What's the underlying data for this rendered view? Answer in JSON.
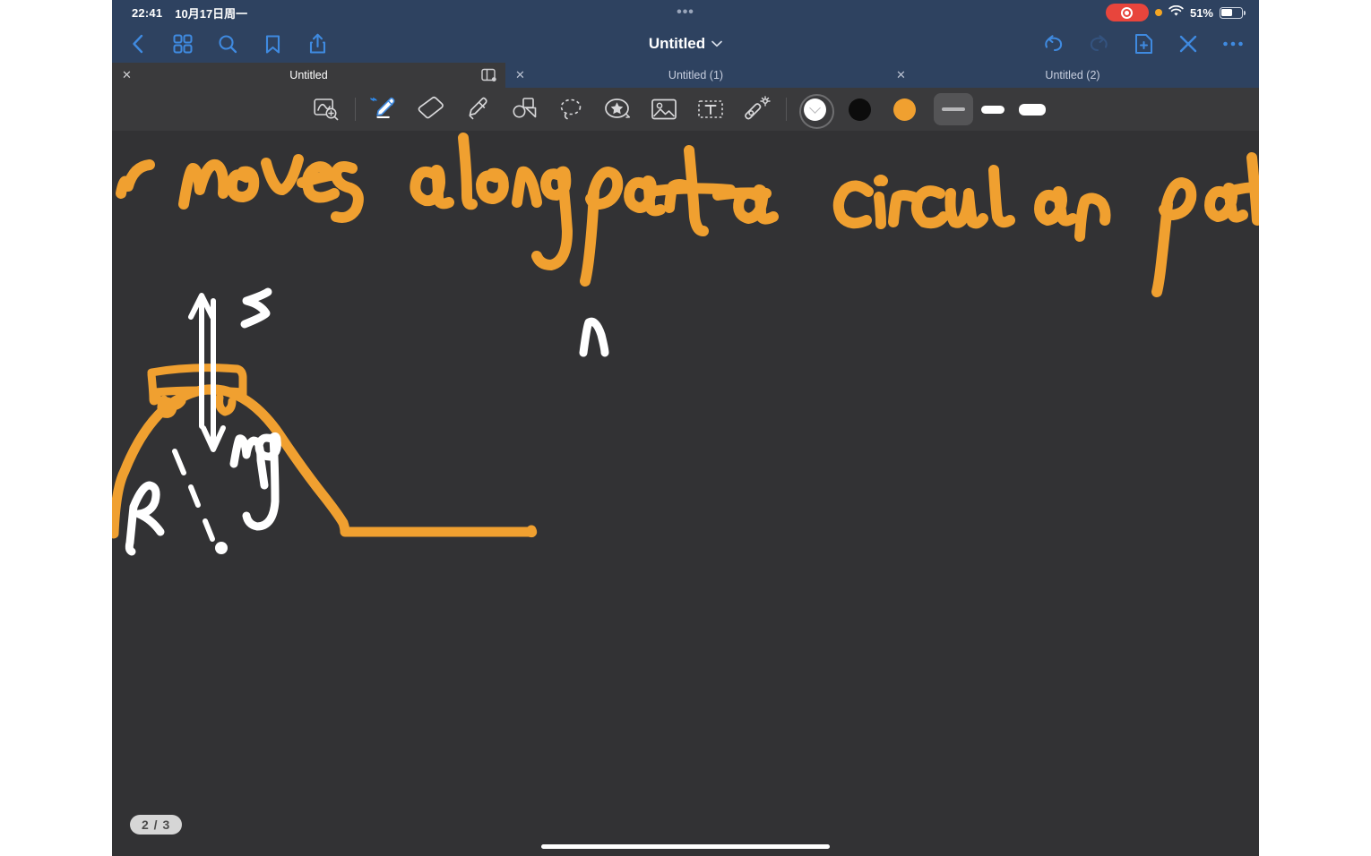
{
  "status_bar": {
    "time": "22:41",
    "date": "10月17日周一",
    "center_dots": "•••",
    "battery_percent": "51%",
    "recording_icon": "record-indicator-icon",
    "orange_dot_icon": "microphone-in-use-dot-icon",
    "wifi_icon": "wifi-icon",
    "battery_icon": "battery-icon"
  },
  "nav_bar": {
    "title": "Untitled",
    "title_chevron_icon": "chevron-down-icon",
    "left_icons": [
      "back-chevron-icon",
      "grid-thumbnails-icon",
      "search-icon",
      "bookmark-icon",
      "share-icon"
    ],
    "right_icons": [
      "undo-icon",
      "redo-icon",
      "add-page-icon",
      "close-icon",
      "more-icon"
    ]
  },
  "tabs": [
    {
      "label": "Untitled",
      "active": true,
      "close_icon": "close-icon",
      "split_icon": "split-view-icon"
    },
    {
      "label": "Untitled (1)",
      "active": false,
      "close_icon": "close-icon"
    },
    {
      "label": "Untitled (2)",
      "active": false,
      "close_icon": "close-icon"
    }
  ],
  "toolbar": {
    "tools": [
      {
        "name": "zoom-box-icon",
        "selected": false
      },
      {
        "name": "pen-icon",
        "selected": true,
        "badge": "bluetooth-icon"
      },
      {
        "name": "eraser-icon",
        "selected": false
      },
      {
        "name": "highlighter-icon",
        "selected": false
      },
      {
        "name": "shapes-icon",
        "selected": false
      },
      {
        "name": "lasso-select-icon",
        "selected": false
      },
      {
        "name": "sticker-icon",
        "selected": false
      },
      {
        "name": "image-icon",
        "selected": false
      },
      {
        "name": "text-box-icon",
        "selected": false
      },
      {
        "name": "laser-pointer-icon",
        "selected": false
      }
    ],
    "colors": [
      {
        "name": "color-white",
        "hex": "#FFFFFF",
        "selected": true
      },
      {
        "name": "color-black",
        "hex": "#0C0C0C",
        "selected": false
      },
      {
        "name": "color-orange",
        "hex": "#F0A030",
        "selected": false
      }
    ],
    "stroke_widths": [
      {
        "name": "stroke-thin",
        "selected": true
      },
      {
        "name": "stroke-medium",
        "selected": false
      },
      {
        "name": "stroke-thick",
        "selected": false
      }
    ]
  },
  "canvas": {
    "background_hex": "#323234",
    "ink_orange_hex": "#F0A030",
    "ink_white_hex": "#FFFFFF",
    "handwriting_text": "r moves along part a circular pat",
    "annotations": [
      {
        "label": "N",
        "color": "#FFFFFF",
        "meaning": "normal-force-label"
      },
      {
        "label": "mg",
        "color": "#FFFFFF",
        "meaning": "weight-force-label"
      },
      {
        "label": "R",
        "color": "#FFFFFF",
        "meaning": "radius-label"
      },
      {
        "label": "n",
        "color": "#FFFFFF",
        "meaning": "handwritten-letter-n"
      }
    ],
    "page_indicator": "2 / 3"
  }
}
